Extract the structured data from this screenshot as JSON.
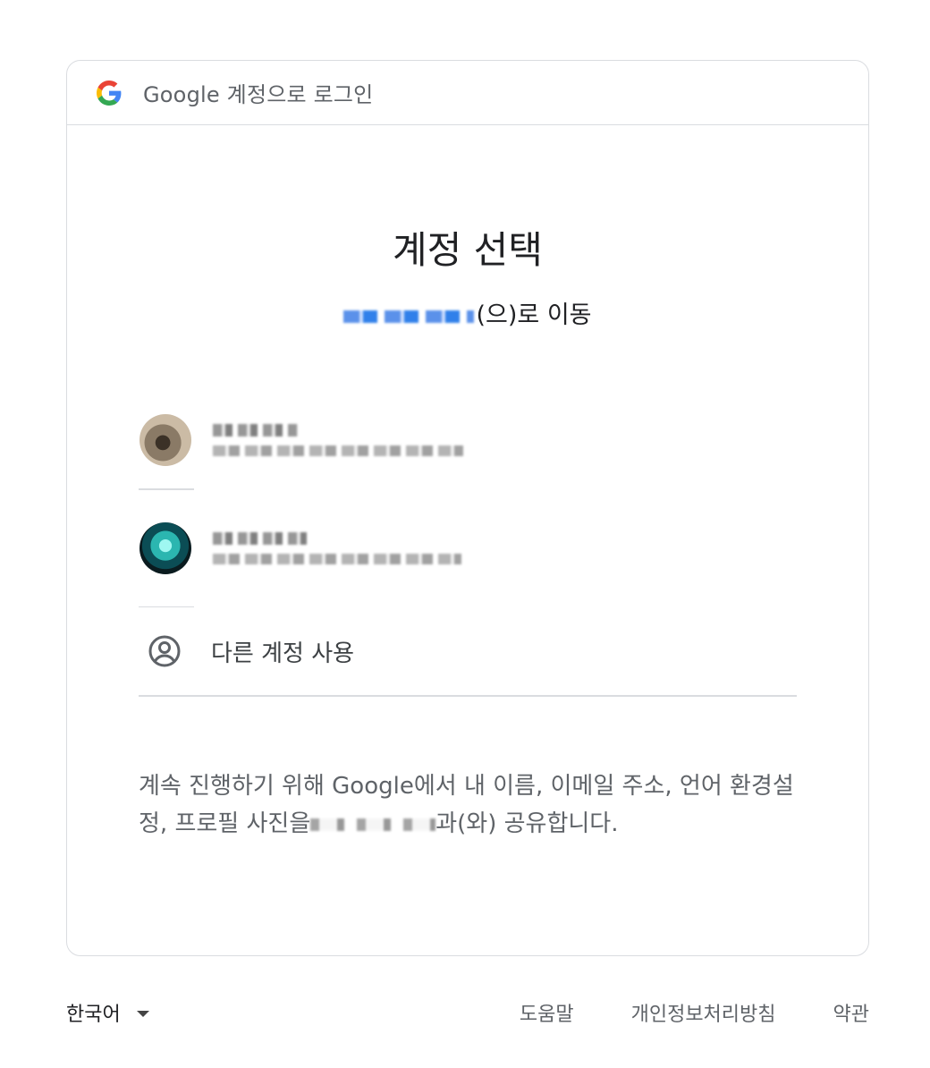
{
  "header": {
    "title": "Google 계정으로 로그인"
  },
  "main": {
    "title": "계정 선택",
    "subtitle_suffix": "(으)로 이동",
    "accounts": [
      {
        "name": "",
        "email": ""
      },
      {
        "name": "",
        "email": ""
      }
    ],
    "use_other_account": "다른 계정 사용",
    "disclaimer_part1": "계속 진행하기 위해 Google에서 내 이름, 이메일 주소, 언어 환경설정, 프로필 사진을",
    "disclaimer_part2": "과(와) 공유합니다."
  },
  "footer": {
    "language": "한국어",
    "help": "도움말",
    "privacy": "개인정보처리방침",
    "terms": "약관"
  },
  "colors": {
    "link_blue": "#1a73e8",
    "divider": "#dadce0",
    "text_secondary": "#5f6368"
  },
  "icons": [
    "google-logo-icon",
    "account-circle-icon",
    "caret-down-icon"
  ]
}
